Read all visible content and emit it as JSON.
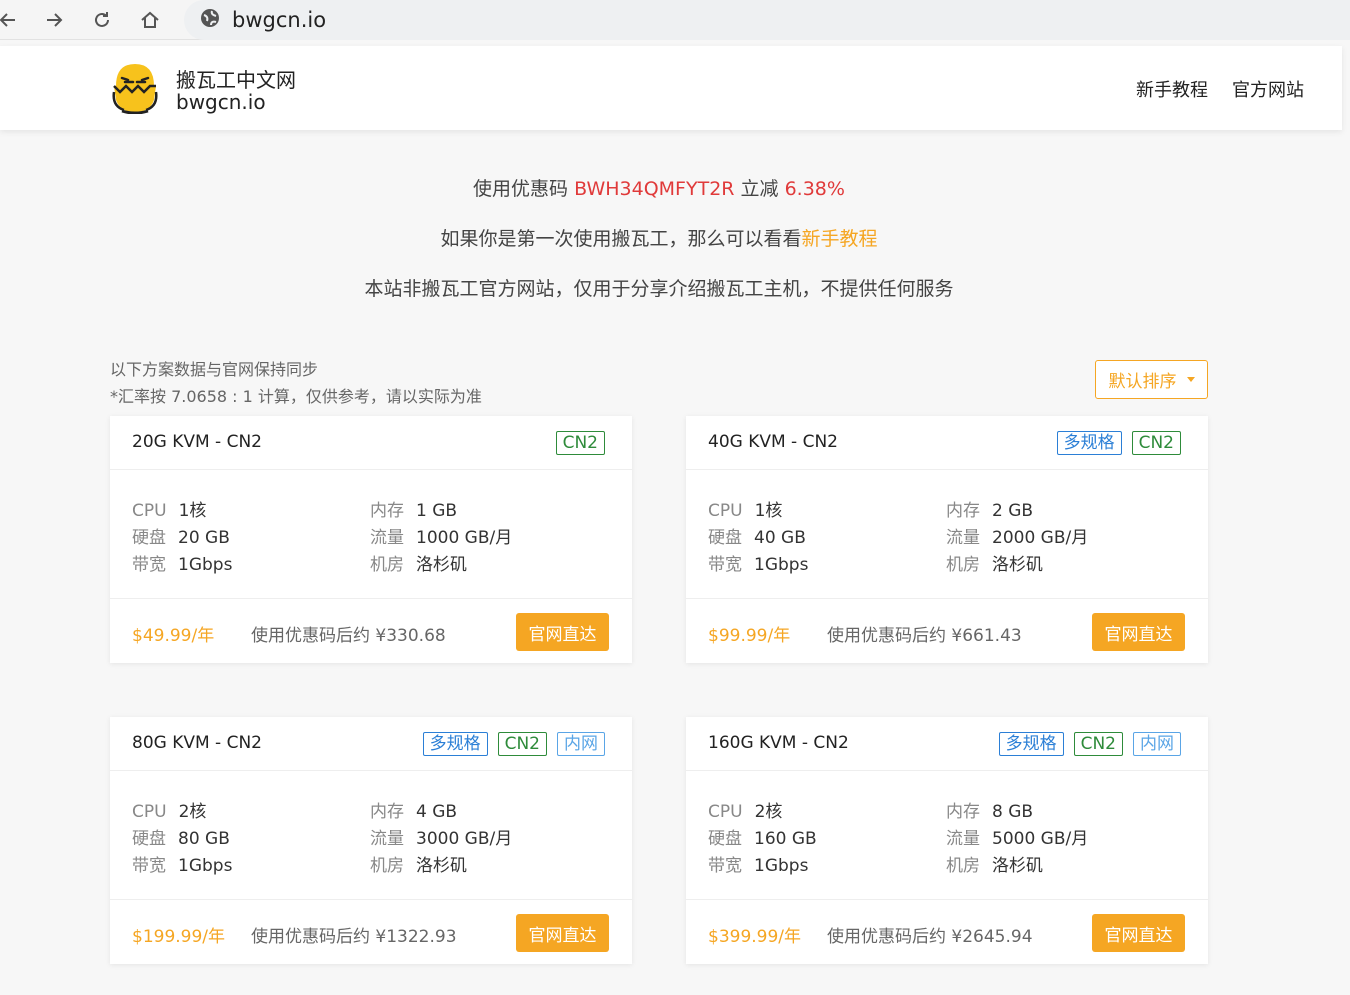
{
  "browser": {
    "url": "bwgcn.io"
  },
  "header": {
    "brand_cn": "搬瓦工中文网",
    "brand_en": "bwgcn.io",
    "nav": [
      "新手教程",
      "官方网站"
    ]
  },
  "notices": {
    "promo_prefix": "使用优惠码",
    "promo_code": "BWH34QMFYT2R",
    "promo_mid": "立减",
    "promo_discount": "6.38%",
    "first_time_prefix": "如果你是第一次使用搬瓦工，那么可以看看",
    "first_time_link": "新手教程",
    "disclaimer": "本站非搬瓦工官方网站，仅用于分享介绍搬瓦工主机，不提供任何服务"
  },
  "sync_note": {
    "line1": "以下方案数据与官网保持同步",
    "line2": "*汇率按 7.0658 : 1 计算，仅供参考，请以实际为准"
  },
  "sort": {
    "label": "默认排序"
  },
  "spec_labels": {
    "cpu": "CPU",
    "ram": "内存",
    "disk": "硬盘",
    "traffic": "流量",
    "bandwidth": "带宽",
    "location": "机房"
  },
  "buy_label": "官网直达",
  "plans": [
    {
      "title": "20G KVM - CN2",
      "tags": [
        "CN2"
      ],
      "cpu": "1核",
      "ram": "1 GB",
      "disk": "20 GB",
      "traffic": "1000 GB/月",
      "bandwidth": "1Gbps",
      "location": "洛杉矶",
      "price": "$49.99/年",
      "after_discount": "使用优惠码后约 ¥330.68"
    },
    {
      "title": "40G KVM - CN2",
      "tags": [
        "多规格",
        "CN2"
      ],
      "cpu": "1核",
      "ram": "2 GB",
      "disk": "40 GB",
      "traffic": "2000 GB/月",
      "bandwidth": "1Gbps",
      "location": "洛杉矶",
      "price": "$99.99/年",
      "after_discount": "使用优惠码后约 ¥661.43"
    },
    {
      "title": "80G KVM - CN2",
      "tags": [
        "多规格",
        "CN2",
        "内网"
      ],
      "cpu": "2核",
      "ram": "4 GB",
      "disk": "80 GB",
      "traffic": "3000 GB/月",
      "bandwidth": "1Gbps",
      "location": "洛杉矶",
      "price": "$199.99/年",
      "after_discount": "使用优惠码后约 ¥1322.93"
    },
    {
      "title": "160G KVM - CN2",
      "tags": [
        "多规格",
        "CN2",
        "内网"
      ],
      "cpu": "2核",
      "ram": "8 GB",
      "disk": "160 GB",
      "traffic": "5000 GB/月",
      "bandwidth": "1Gbps",
      "location": "洛杉矶",
      "price": "$399.99/年",
      "after_discount": "使用优惠码后约 ¥2645.94"
    }
  ],
  "colors": {
    "accent": "#f5a623",
    "promo": "#e03a3a",
    "tag_multi": "#2b7fd6",
    "tag_cn2": "#2e8b3a",
    "tag_intranet": "#5aa5e6"
  }
}
